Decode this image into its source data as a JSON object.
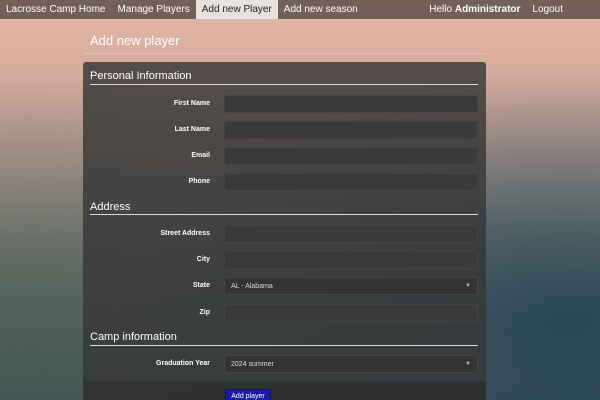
{
  "nav": {
    "home": "Lacrosse Camp Home",
    "manage": "Manage Players",
    "add_player": "Add new Player",
    "add_season": "Add new season",
    "hello_prefix": "Hello",
    "user": "Administrator",
    "logout": "Logout"
  },
  "page": {
    "title": "Add new player"
  },
  "sections": {
    "personal": "Personal Information",
    "address": "Address",
    "camp": "Camp information"
  },
  "fields": {
    "first_name": {
      "label": "First Name",
      "value": ""
    },
    "last_name": {
      "label": "Last Name",
      "value": ""
    },
    "email": {
      "label": "Email",
      "value": ""
    },
    "phone": {
      "label": "Phone",
      "value": ""
    },
    "street": {
      "label": "Street Address",
      "value": ""
    },
    "city": {
      "label": "City",
      "value": ""
    },
    "state": {
      "label": "State",
      "selected": "AL - Alabama"
    },
    "zip": {
      "label": "Zip",
      "value": ""
    },
    "grad_year": {
      "label": "Graduation Year",
      "selected": "2024 summer"
    }
  },
  "submit": {
    "label": "Add player"
  },
  "colors": {
    "nav_bg": "#695852",
    "active_tab_bg": "#e8e2de",
    "button_bg": "#1b1ba8"
  },
  "icons": {
    "select_arrow": "chevron-down-icon"
  }
}
